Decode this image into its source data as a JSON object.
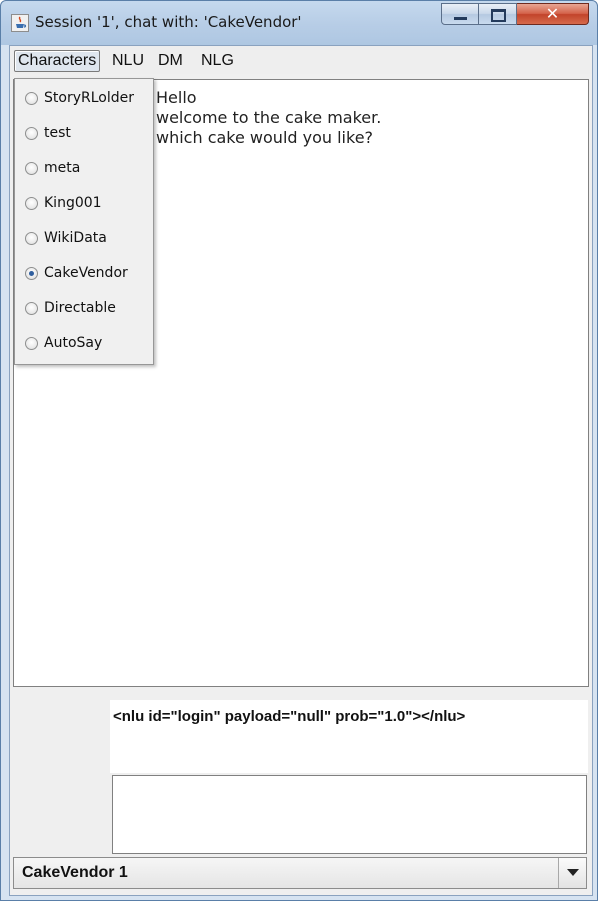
{
  "window": {
    "title": "Session '1', chat with: 'CakeVendor'",
    "icon": "java-icon",
    "controls": [
      "minimize-icon",
      "maximize-icon",
      "close-icon"
    ],
    "close_symbol": "✕"
  },
  "menubar": {
    "items": [
      {
        "label": "Characters",
        "active": true
      },
      {
        "label": "NLU",
        "active": false
      },
      {
        "label": "DM",
        "active": false
      },
      {
        "label": "NLG",
        "active": false
      }
    ]
  },
  "characters_menu": {
    "options": [
      {
        "label": "StoryRLolder",
        "selected": false
      },
      {
        "label": "test",
        "selected": false
      },
      {
        "label": "meta",
        "selected": false
      },
      {
        "label": "King001",
        "selected": false
      },
      {
        "label": "WikiData",
        "selected": false
      },
      {
        "label": "CakeVendor",
        "selected": true
      },
      {
        "label": "Directable",
        "selected": false
      },
      {
        "label": "AutoSay",
        "selected": false
      }
    ]
  },
  "chat": {
    "lines": [
      "Hello",
      "welcome to the cake maker.",
      "which cake would you like?"
    ]
  },
  "nlu": {
    "output": "<nlu id=\"login\" payload=\"null\" prob=\"1.0\"></nlu>"
  },
  "input": {
    "value": ""
  },
  "session_select": {
    "selected": "CakeVendor 1"
  },
  "colors": {
    "selected_radio": "#2f5e9e",
    "close_button": "#c2432a",
    "title_bar": "#b7cde6"
  }
}
